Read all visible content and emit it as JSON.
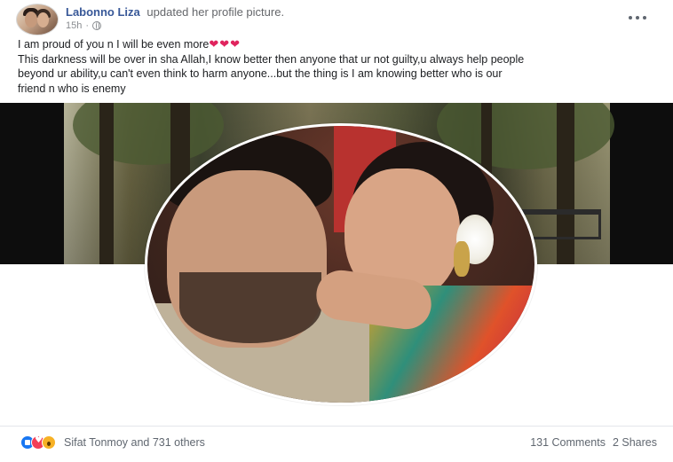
{
  "post": {
    "author": "Labonno Liza",
    "action": "updated her profile picture.",
    "time": "15h",
    "more_label": "•••",
    "text_lines": [
      "I am proud of you n I will be even more",
      "This darkness will be over in sha Allah,I know better then anyone that ur not guilty,u always help people",
      "beyond ur ability,u can't even think to harm anyone...but the thing is I am knowing better who is our",
      "friend n who is enemy"
    ],
    "hearts": "❤❤❤"
  },
  "reactions": {
    "icons": [
      "like-icon",
      "love-icon",
      "wow-icon"
    ],
    "text": "Sifat Tonmoy and 731 others",
    "comments": "131 Comments",
    "shares": "2 Shares"
  },
  "colors": {
    "name_blue": "#385898",
    "like_blue": "#1877f2",
    "love_red": "#f33e58",
    "wow_yellow": "#f7b125",
    "heart_red": "#e0245e"
  }
}
